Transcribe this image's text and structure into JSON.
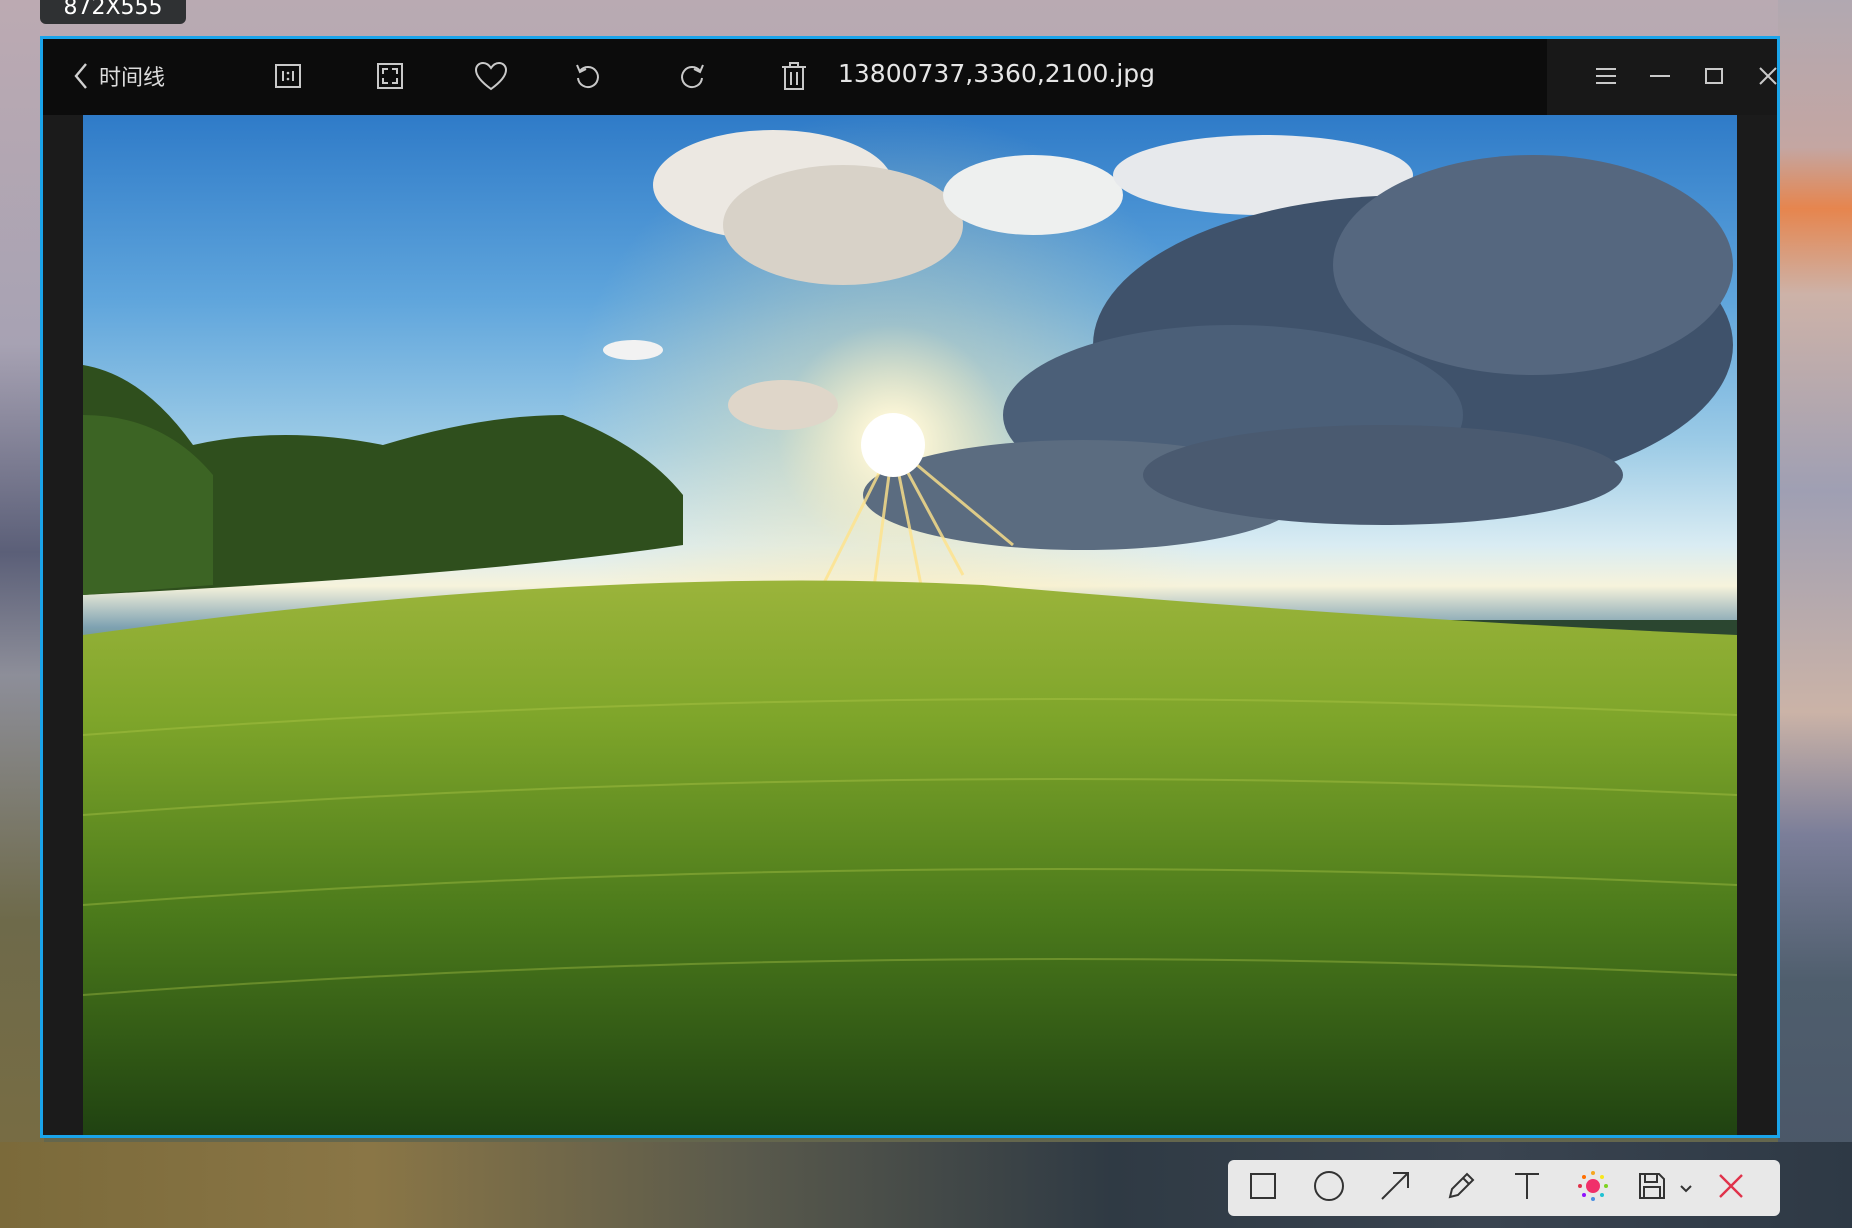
{
  "overlay": {
    "size_label": "872X555"
  },
  "window": {
    "back_label": "时间线",
    "filename": "13800737,3360,2100.jpg"
  },
  "toolbar_icons": [
    "back-icon",
    "actual-size-icon",
    "fit-screen-icon",
    "favorite-icon",
    "rotate-left-icon",
    "rotate-right-icon",
    "delete-icon"
  ],
  "window_controls": [
    "menu-icon",
    "minimize-icon",
    "maximize-icon",
    "close-icon"
  ],
  "annotation_tools": [
    "rectangle-icon",
    "ellipse-icon",
    "arrow-icon",
    "pen-icon",
    "text-icon",
    "color-picker-icon",
    "save-icon",
    "dropdown-chevron-icon",
    "cancel-icon"
  ],
  "colors": {
    "accent_border": "#1aa4ea",
    "titlebar": "#0c0c0c",
    "cancel": "#e0324a"
  }
}
